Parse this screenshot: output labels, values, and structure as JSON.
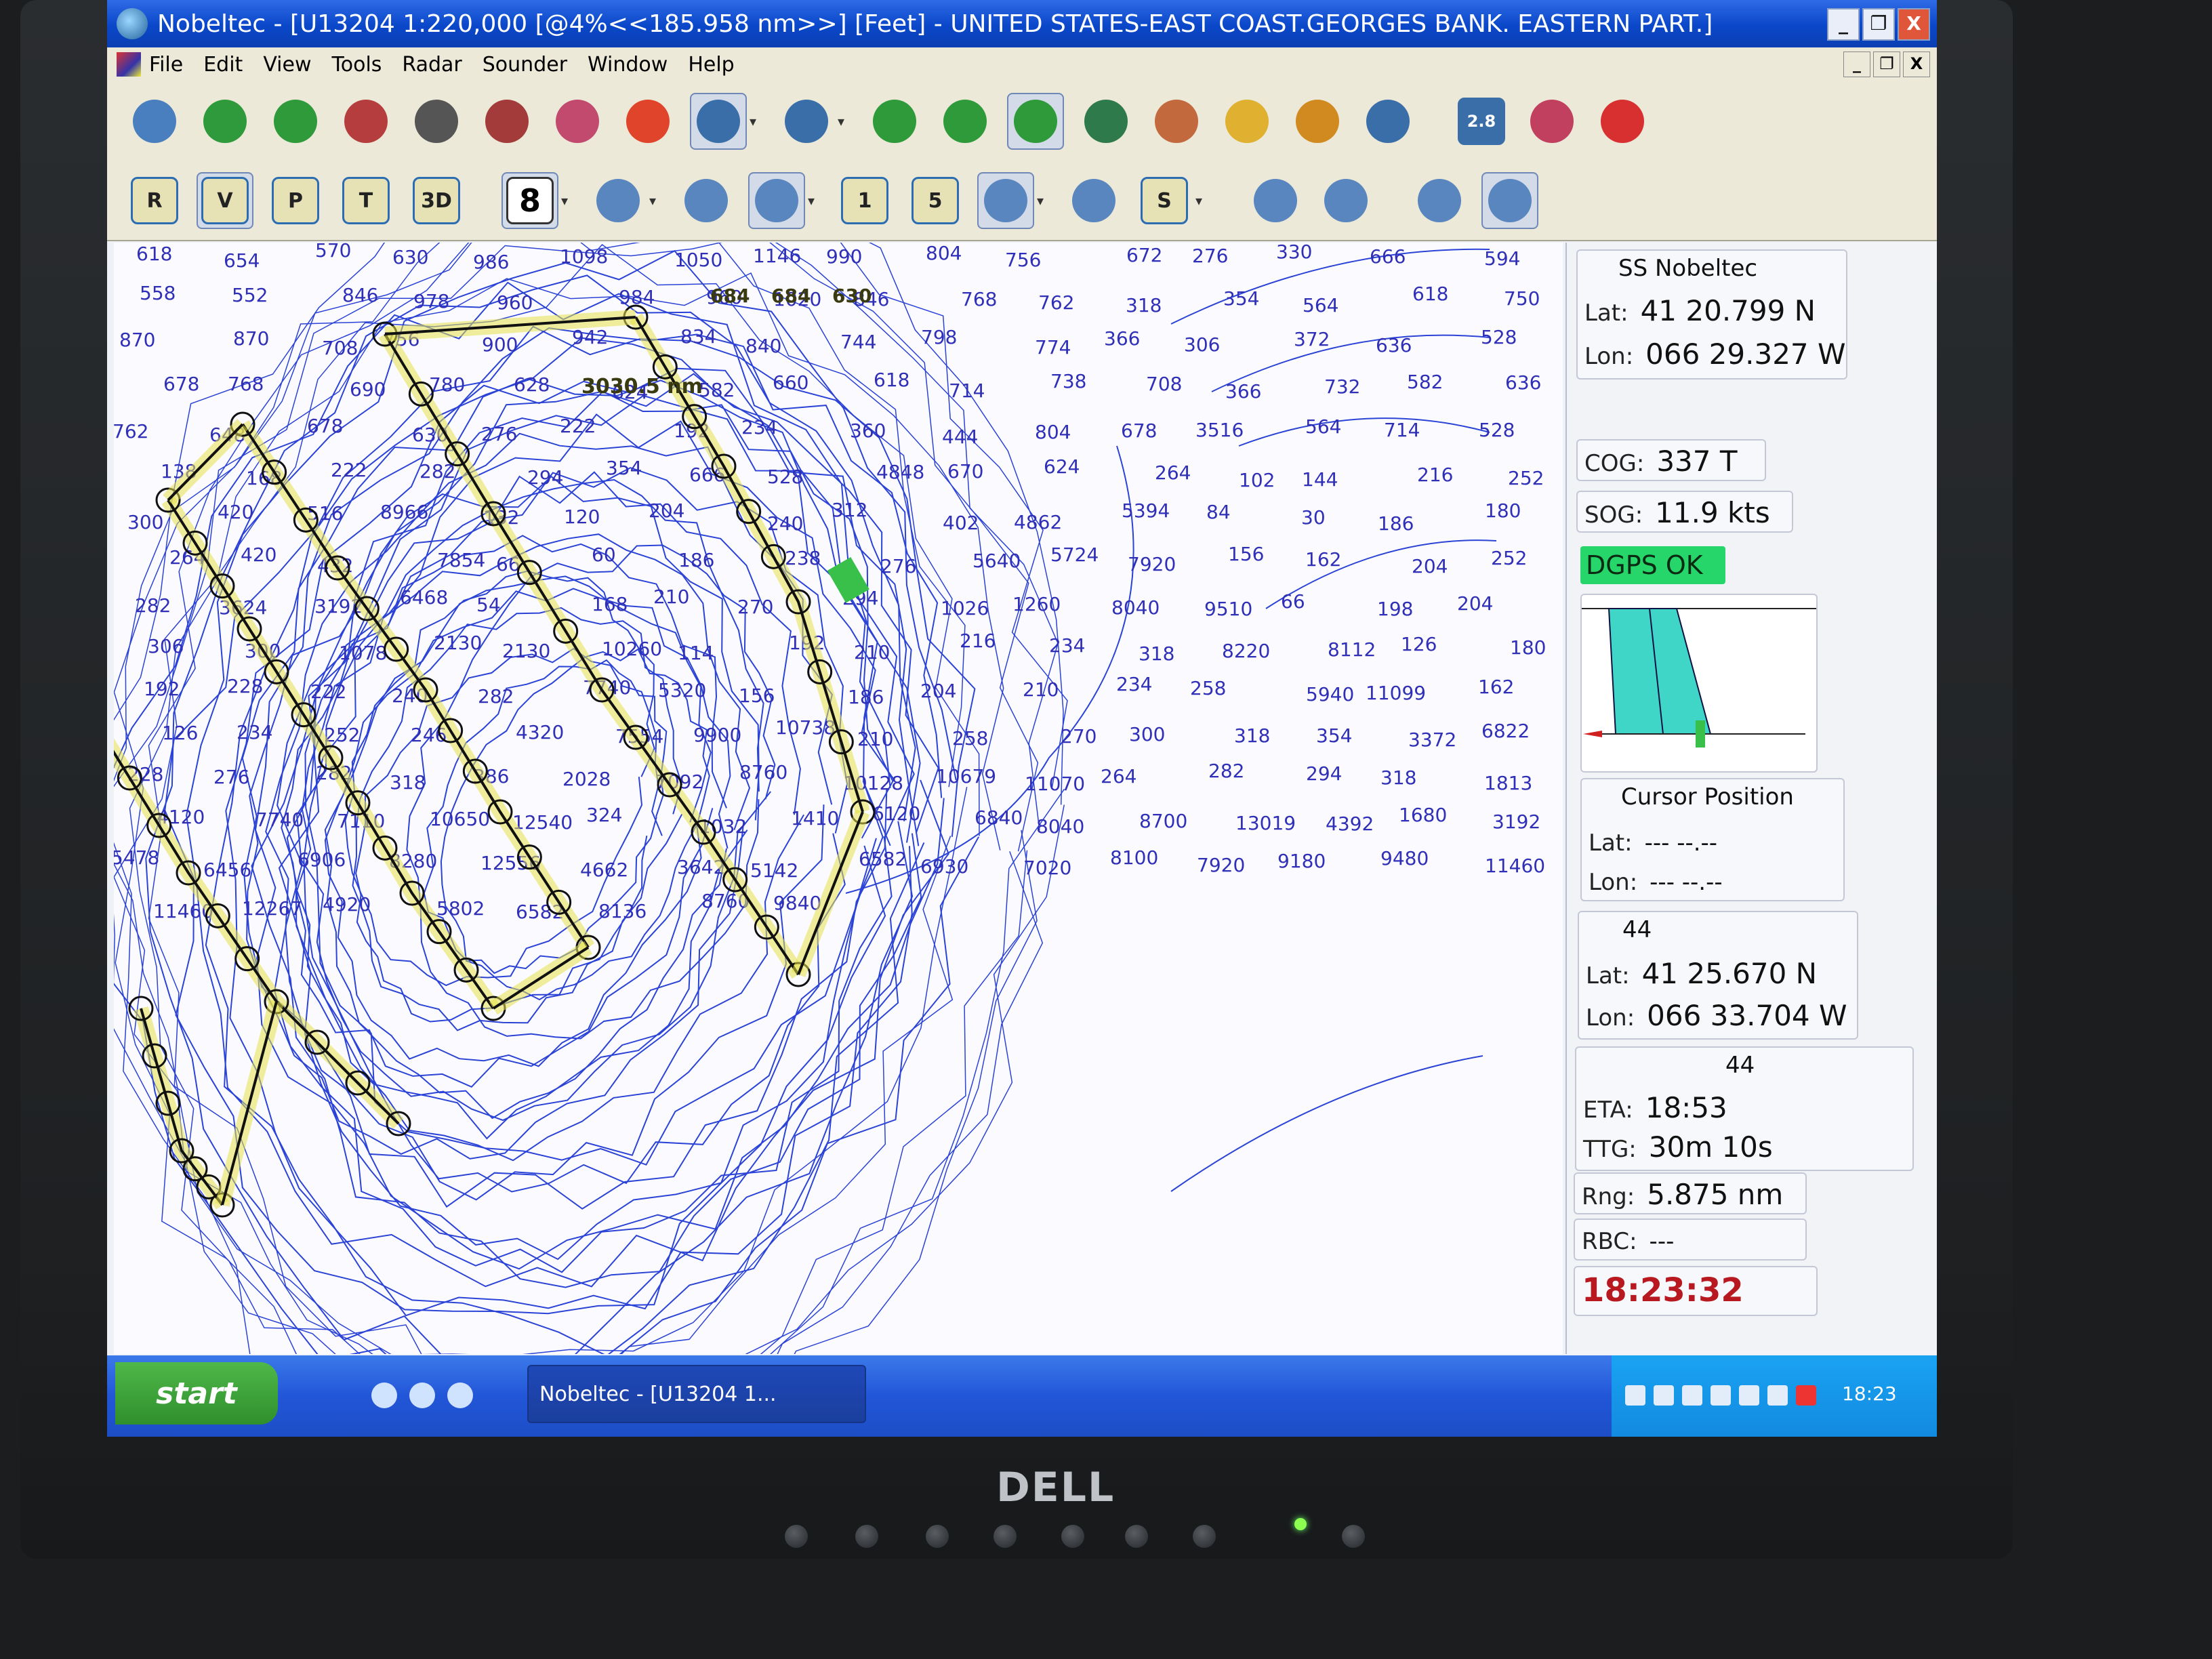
{
  "window": {
    "title": "Nobeltec - [U13204 1:220,000 [@4%<<185.958 nm>>] [Feet] - UNITED STATES-EAST COAST.GEORGES BANK. EASTERN PART.]",
    "controls": [
      "_",
      "❐",
      "X"
    ]
  },
  "menu": [
    "File",
    "Edit",
    "View",
    "Tools",
    "Radar",
    "Sounder",
    "Window",
    "Help"
  ],
  "toolbar1": [
    {
      "icon": "chart-list-icon",
      "color": "#4a7fbf"
    },
    {
      "icon": "info-tag-icon",
      "color": "#2f9a3c"
    },
    {
      "icon": "route-pen-icon",
      "color": "#2e9a3a"
    },
    {
      "icon": "route-edit-icon",
      "color": "#b53d3d"
    },
    {
      "icon": "zoom-box-icon",
      "color": "#555555"
    },
    {
      "icon": "boat-3d-icon",
      "color": "#a33b3b"
    },
    {
      "icon": "vessel-icon",
      "color": "#c14a6e"
    },
    {
      "icon": "lifebuoy-icon",
      "color": "#e0452b"
    },
    {
      "icon": "hourglass-search-icon",
      "color": "#3a6ea8",
      "pressed": true,
      "dropdown": true
    },
    {
      "icon": "zoom-in-icon",
      "color": "#3a6ea8",
      "dropdown": true
    },
    {
      "icon": "marker-green-icon",
      "color": "#2e9a3a"
    },
    {
      "icon": "crossed-markers-icon",
      "color": "#2e9a3a"
    },
    {
      "icon": "track-line-icon",
      "color": "#2e9a3a",
      "pressed": true
    },
    {
      "icon": "target-circle-icon",
      "color": "#2e7a4a"
    },
    {
      "icon": "layers-icon",
      "color": "#c2693d"
    },
    {
      "icon": "weather-cloud-icon",
      "color": "#e0b030"
    },
    {
      "icon": "gear-icon",
      "color": "#d08a20"
    },
    {
      "icon": "split-view-icon",
      "color": "#3a6ea8"
    },
    {
      "icon": "range-measure-icon",
      "color": "#3a6ea8",
      "label": "2.8"
    },
    {
      "icon": "bar-chart-icon",
      "color": "#c13f5f"
    },
    {
      "icon": "red-arrow-icon",
      "color": "#d83030"
    }
  ],
  "toolbar2": [
    {
      "icon": "route-r-icon",
      "label": "R"
    },
    {
      "icon": "vector-v-icon",
      "label": "V",
      "pressed": true
    },
    {
      "icon": "plot-p-icon",
      "label": "P"
    },
    {
      "icon": "tide-t-icon",
      "label": "T"
    },
    {
      "icon": "view-3d-icon",
      "label": "3D"
    },
    {
      "icon": "number-8-icon",
      "label": "8",
      "pressed": true,
      "dropdown": true
    },
    {
      "icon": "red-pin-icon",
      "dropdown": true
    },
    {
      "icon": "chart-page-icon"
    },
    {
      "icon": "wave-layer-icon",
      "pressed": true,
      "dropdown": true
    },
    {
      "icon": "info-circle-icon",
      "label": "1"
    },
    {
      "icon": "speed-5-icon",
      "label": "5"
    },
    {
      "icon": "anchor-icon",
      "pressed": true,
      "dropdown": true
    },
    {
      "icon": "palette-icon"
    },
    {
      "icon": "scale-s-icon",
      "label": "S",
      "dropdown": true
    },
    {
      "icon": "warning-icon"
    },
    {
      "icon": "hand-book-icon"
    },
    {
      "icon": "pointer-figure-icon"
    },
    {
      "icon": "diamond-icon",
      "pressed": true
    }
  ],
  "panel": {
    "vessel_name": "SS Nobeltec",
    "lat_label": "Lat:",
    "lon_label": "Lon:",
    "vessel_lat": "41 20.799 N",
    "vessel_lon": "066 29.327 W",
    "cog_label": "COG:",
    "cog": "337 T",
    "sog_label": "SOG:",
    "sog": "11.9 kts",
    "gps_status": "DGPS OK",
    "cursor_title": "Cursor Position",
    "cursor_lat": "--- --.--",
    "cursor_lon": "--- --.--",
    "wp_id": "44",
    "wp_lat": "41 25.670 N",
    "wp_lon": "066 33.704 W",
    "eta_label": "ETA:",
    "eta": "18:53",
    "ttg_label": "TTG:",
    "ttg": "30m 10s",
    "rng_label": "Rng:",
    "rng": "5.875 nm",
    "rbc_label": "RBC:",
    "rbc": "---",
    "clock": "18:23:32"
  },
  "taskbar": {
    "start": "start",
    "task": "Nobeltec - [U13204 1...",
    "time": "18:23"
  },
  "monitor_brand": "DELL",
  "chart": {
    "top_label": "3030.5 nm",
    "route_labels": [
      "684",
      "684",
      "630"
    ],
    "soundings": [
      "618",
      "654",
      "570",
      "630",
      "986",
      "1098",
      "1050",
      "1146",
      "990",
      "804",
      "756",
      "672",
      "276",
      "330",
      "666",
      "594",
      "558",
      "552",
      "846",
      "978",
      "960",
      "984",
      "960",
      "1020",
      "846",
      "768",
      "762",
      "318",
      "354",
      "564",
      "618",
      "750",
      "870",
      "870",
      "708",
      "756",
      "900",
      "942",
      "834",
      "840",
      "744",
      "798",
      "774",
      "366",
      "306",
      "372",
      "636",
      "528",
      "678",
      "768",
      "690",
      "780",
      "628",
      "624",
      "582",
      "660",
      "618",
      "714",
      "738",
      "708",
      "366",
      "732",
      "582",
      "636",
      "762",
      "648",
      "678",
      "630",
      "276",
      "222",
      "192",
      "234",
      "360",
      "444",
      "804",
      "678",
      "3516",
      "564",
      "714",
      "528",
      "138",
      "168",
      "222",
      "282",
      "294",
      "354",
      "666",
      "528",
      "4848",
      "670",
      "624",
      "264",
      "102",
      "144",
      "216",
      "252",
      "300",
      "420",
      "516",
      "8966",
      "132",
      "120",
      "204",
      "240",
      "312",
      "402",
      "4862",
      "5394",
      "84",
      "30",
      "186",
      "180",
      "264",
      "420",
      "432",
      "7854",
      "66",
      "60",
      "186",
      "238",
      "276",
      "5640",
      "5724",
      "7920",
      "156",
      "162",
      "204",
      "252",
      "282",
      "3624",
      "3192",
      "6468",
      "54",
      "168",
      "210",
      "270",
      "294",
      "1026",
      "1260",
      "8040",
      "9510",
      "66",
      "198",
      "204",
      "306",
      "300",
      "1078",
      "2130",
      "2130",
      "10260",
      "114",
      "192",
      "210",
      "216",
      "234",
      "318",
      "8220",
      "8112",
      "126",
      "180",
      "192",
      "228",
      "222",
      "240",
      "282",
      "7740",
      "5320",
      "156",
      "186",
      "204",
      "210",
      "234",
      "258",
      "5940",
      "11099",
      "162",
      "126",
      "234",
      "252",
      "246",
      "4320",
      "7554",
      "9900",
      "10738",
      "210",
      "258",
      "270",
      "300",
      "318",
      "354",
      "3372",
      "6822",
      "228",
      "276",
      "282",
      "318",
      "386",
      "2028",
      "7092",
      "8760",
      "10128",
      "10679",
      "11070",
      "264",
      "282",
      "294",
      "318",
      "1813",
      "4120",
      "7740",
      "7110",
      "10650",
      "12540",
      "324",
      "1032",
      "1410",
      "6120",
      "6840",
      "8040",
      "8700",
      "13019",
      "4392",
      "1680",
      "3192",
      "5478",
      "6456",
      "6906",
      "8280",
      "12556",
      "4662",
      "3642",
      "5142",
      "6582",
      "6930",
      "7020",
      "8100",
      "7920",
      "9180",
      "9480",
      "11460",
      "11460",
      "12267",
      "4920",
      "5802",
      "6582",
      "8136",
      "8760",
      "9840"
    ]
  }
}
